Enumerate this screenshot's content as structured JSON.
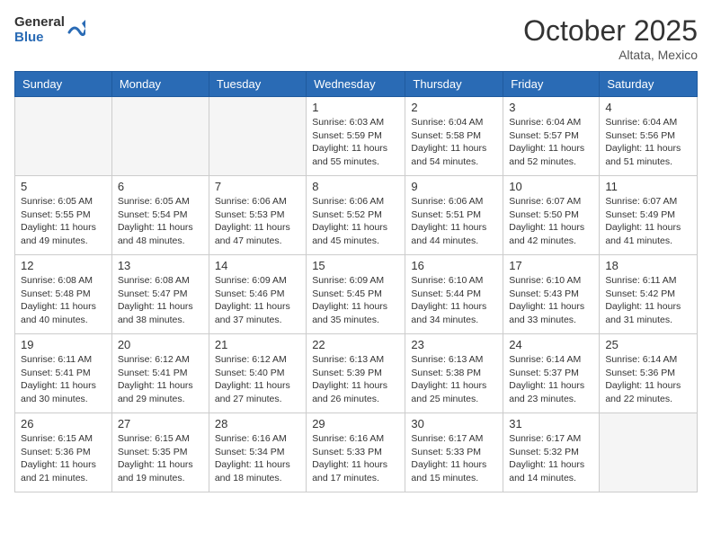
{
  "header": {
    "logo_general": "General",
    "logo_blue": "Blue",
    "month_title": "October 2025",
    "location": "Altata, Mexico"
  },
  "days_of_week": [
    "Sunday",
    "Monday",
    "Tuesday",
    "Wednesday",
    "Thursday",
    "Friday",
    "Saturday"
  ],
  "weeks": [
    [
      {
        "day": "",
        "info": ""
      },
      {
        "day": "",
        "info": ""
      },
      {
        "day": "",
        "info": ""
      },
      {
        "day": "1",
        "info": "Sunrise: 6:03 AM\nSunset: 5:59 PM\nDaylight: 11 hours and 55 minutes."
      },
      {
        "day": "2",
        "info": "Sunrise: 6:04 AM\nSunset: 5:58 PM\nDaylight: 11 hours and 54 minutes."
      },
      {
        "day": "3",
        "info": "Sunrise: 6:04 AM\nSunset: 5:57 PM\nDaylight: 11 hours and 52 minutes."
      },
      {
        "day": "4",
        "info": "Sunrise: 6:04 AM\nSunset: 5:56 PM\nDaylight: 11 hours and 51 minutes."
      }
    ],
    [
      {
        "day": "5",
        "info": "Sunrise: 6:05 AM\nSunset: 5:55 PM\nDaylight: 11 hours and 49 minutes."
      },
      {
        "day": "6",
        "info": "Sunrise: 6:05 AM\nSunset: 5:54 PM\nDaylight: 11 hours and 48 minutes."
      },
      {
        "day": "7",
        "info": "Sunrise: 6:06 AM\nSunset: 5:53 PM\nDaylight: 11 hours and 47 minutes."
      },
      {
        "day": "8",
        "info": "Sunrise: 6:06 AM\nSunset: 5:52 PM\nDaylight: 11 hours and 45 minutes."
      },
      {
        "day": "9",
        "info": "Sunrise: 6:06 AM\nSunset: 5:51 PM\nDaylight: 11 hours and 44 minutes."
      },
      {
        "day": "10",
        "info": "Sunrise: 6:07 AM\nSunset: 5:50 PM\nDaylight: 11 hours and 42 minutes."
      },
      {
        "day": "11",
        "info": "Sunrise: 6:07 AM\nSunset: 5:49 PM\nDaylight: 11 hours and 41 minutes."
      }
    ],
    [
      {
        "day": "12",
        "info": "Sunrise: 6:08 AM\nSunset: 5:48 PM\nDaylight: 11 hours and 40 minutes."
      },
      {
        "day": "13",
        "info": "Sunrise: 6:08 AM\nSunset: 5:47 PM\nDaylight: 11 hours and 38 minutes."
      },
      {
        "day": "14",
        "info": "Sunrise: 6:09 AM\nSunset: 5:46 PM\nDaylight: 11 hours and 37 minutes."
      },
      {
        "day": "15",
        "info": "Sunrise: 6:09 AM\nSunset: 5:45 PM\nDaylight: 11 hours and 35 minutes."
      },
      {
        "day": "16",
        "info": "Sunrise: 6:10 AM\nSunset: 5:44 PM\nDaylight: 11 hours and 34 minutes."
      },
      {
        "day": "17",
        "info": "Sunrise: 6:10 AM\nSunset: 5:43 PM\nDaylight: 11 hours and 33 minutes."
      },
      {
        "day": "18",
        "info": "Sunrise: 6:11 AM\nSunset: 5:42 PM\nDaylight: 11 hours and 31 minutes."
      }
    ],
    [
      {
        "day": "19",
        "info": "Sunrise: 6:11 AM\nSunset: 5:41 PM\nDaylight: 11 hours and 30 minutes."
      },
      {
        "day": "20",
        "info": "Sunrise: 6:12 AM\nSunset: 5:41 PM\nDaylight: 11 hours and 29 minutes."
      },
      {
        "day": "21",
        "info": "Sunrise: 6:12 AM\nSunset: 5:40 PM\nDaylight: 11 hours and 27 minutes."
      },
      {
        "day": "22",
        "info": "Sunrise: 6:13 AM\nSunset: 5:39 PM\nDaylight: 11 hours and 26 minutes."
      },
      {
        "day": "23",
        "info": "Sunrise: 6:13 AM\nSunset: 5:38 PM\nDaylight: 11 hours and 25 minutes."
      },
      {
        "day": "24",
        "info": "Sunrise: 6:14 AM\nSunset: 5:37 PM\nDaylight: 11 hours and 23 minutes."
      },
      {
        "day": "25",
        "info": "Sunrise: 6:14 AM\nSunset: 5:36 PM\nDaylight: 11 hours and 22 minutes."
      }
    ],
    [
      {
        "day": "26",
        "info": "Sunrise: 6:15 AM\nSunset: 5:36 PM\nDaylight: 11 hours and 21 minutes."
      },
      {
        "day": "27",
        "info": "Sunrise: 6:15 AM\nSunset: 5:35 PM\nDaylight: 11 hours and 19 minutes."
      },
      {
        "day": "28",
        "info": "Sunrise: 6:16 AM\nSunset: 5:34 PM\nDaylight: 11 hours and 18 minutes."
      },
      {
        "day": "29",
        "info": "Sunrise: 6:16 AM\nSunset: 5:33 PM\nDaylight: 11 hours and 17 minutes."
      },
      {
        "day": "30",
        "info": "Sunrise: 6:17 AM\nSunset: 5:33 PM\nDaylight: 11 hours and 15 minutes."
      },
      {
        "day": "31",
        "info": "Sunrise: 6:17 AM\nSunset: 5:32 PM\nDaylight: 11 hours and 14 minutes."
      },
      {
        "day": "",
        "info": ""
      }
    ]
  ]
}
